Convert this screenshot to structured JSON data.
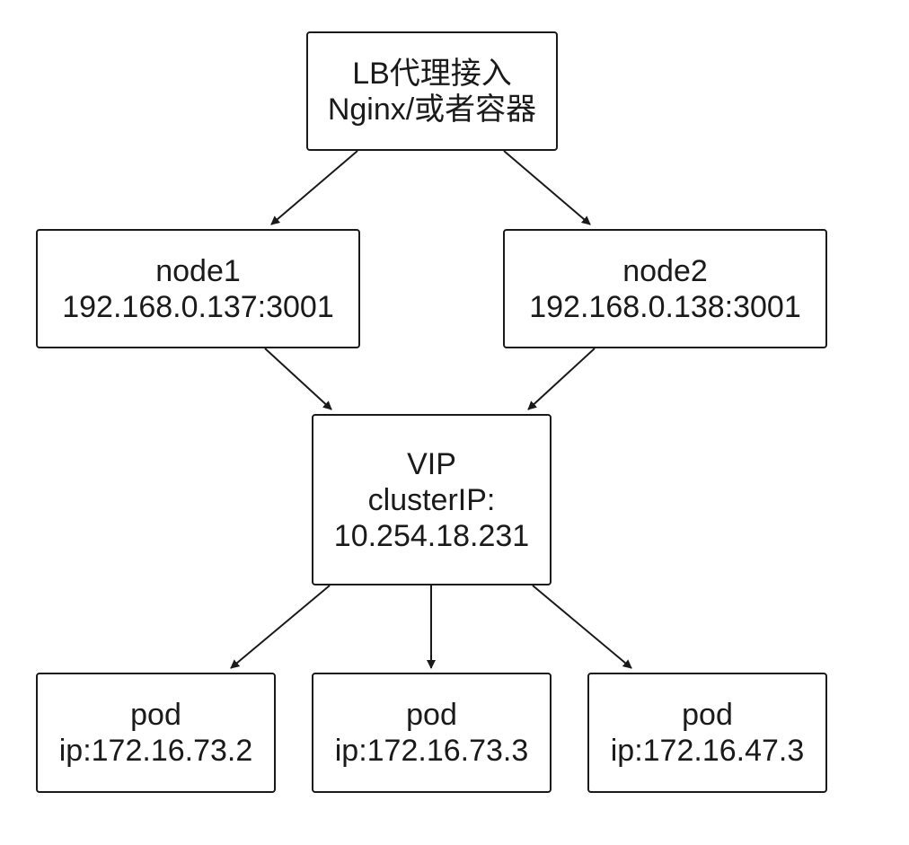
{
  "diagram": {
    "lb": {
      "line1": "LB代理接入",
      "line2": "Nginx/或者容器"
    },
    "node1": {
      "line1": "node1",
      "line2": "192.168.0.137:3001"
    },
    "node2": {
      "line1": "node2",
      "line2": "192.168.0.138:3001"
    },
    "vip": {
      "line1": "VIP",
      "line2": "clusterIP:",
      "line3": "10.254.18.231"
    },
    "pods": [
      {
        "line1": "pod",
        "line2": "ip:172.16.73.2"
      },
      {
        "line1": "pod",
        "line2": "ip:172.16.73.3"
      },
      {
        "line1": "pod",
        "line2": "ip:172.16.47.3"
      }
    ],
    "edges": [
      {
        "from": "lb",
        "to": "node1"
      },
      {
        "from": "lb",
        "to": "node2"
      },
      {
        "from": "node1",
        "to": "vip"
      },
      {
        "from": "node2",
        "to": "vip"
      },
      {
        "from": "vip",
        "to": "pod1"
      },
      {
        "from": "vip",
        "to": "pod2"
      },
      {
        "from": "vip",
        "to": "pod3"
      }
    ],
    "colors": {
      "stroke": "#1a1a1a",
      "background": "#ffffff"
    }
  }
}
